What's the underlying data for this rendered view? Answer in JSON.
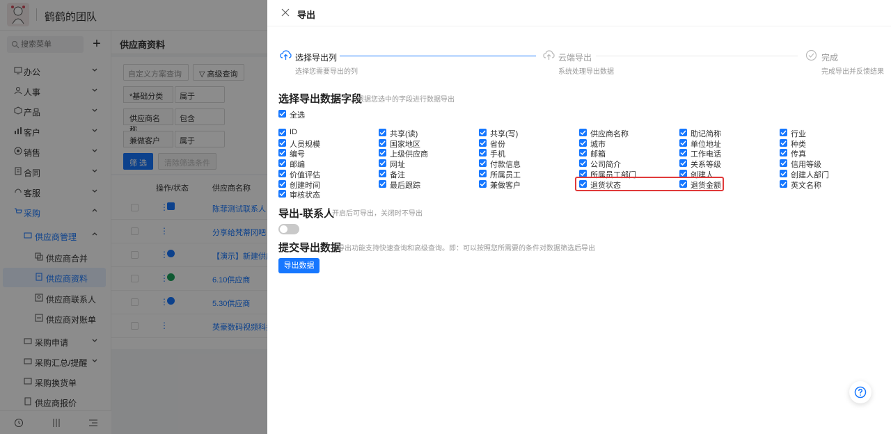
{
  "header": {
    "team_name": "鹤鹤的团队"
  },
  "sidebar": {
    "search_placeholder": "搜索菜单",
    "items": [
      {
        "label": "办公",
        "icon": "desktop-icon"
      },
      {
        "label": "人事",
        "icon": "people-icon"
      },
      {
        "label": "产品",
        "icon": "cube-icon"
      },
      {
        "label": "客户",
        "icon": "chart-icon"
      },
      {
        "label": "销售",
        "icon": "target-icon"
      },
      {
        "label": "合同",
        "icon": "contract-icon"
      },
      {
        "label": "客服",
        "icon": "headset-icon"
      },
      {
        "label": "采购",
        "icon": "cart-icon"
      },
      {
        "label": "供应商管理",
        "icon": "folder-icon"
      },
      {
        "label": "供应商合并",
        "icon": "merge-icon"
      },
      {
        "label": "供应商资料",
        "icon": "document-icon"
      },
      {
        "label": "供应商联系人",
        "icon": "contact-icon"
      },
      {
        "label": "供应商对账单",
        "icon": "statement-icon"
      },
      {
        "label": "采购申请",
        "icon": "folder-icon"
      },
      {
        "label": "采购汇总/提醒",
        "icon": "folder-icon"
      },
      {
        "label": "采购换货单",
        "icon": "exchange-icon"
      },
      {
        "label": "供应商报价",
        "icon": "quote-icon"
      }
    ]
  },
  "main": {
    "title": "供应商资料",
    "custom_query": "自定义方案查询",
    "advanced_query": "高级查询",
    "filters": [
      {
        "label": "*基础分类",
        "op": "属于"
      },
      {
        "label": "供应商名称",
        "op": "包含"
      },
      {
        "label": "兼做客户",
        "op": "属于"
      }
    ],
    "filter_button": "筛 选",
    "clear_button": "清除筛选条件",
    "columns": [
      "操作/状态",
      "供应商名称"
    ],
    "rows": [
      "陈菲测试联系人",
      "分享给梵蒂冈吧",
      "【演示】新建供应商",
      "6.10供应商",
      "5.30供应商",
      "英豪数码视频科技"
    ]
  },
  "drawer": {
    "title": "导出",
    "steps": [
      {
        "title": "选择导出列",
        "desc": "选择您需要导出的列"
      },
      {
        "title": "云端导出",
        "desc": "系统处理导出数据"
      },
      {
        "title": "完成",
        "desc": "完成导出并反馈结果"
      }
    ],
    "fields_section": {
      "title": "选择导出数据字段",
      "hint": "根据您选中的字段进行数据导出"
    },
    "select_all": "全选",
    "fields": [
      "ID",
      "人员规模",
      "编号",
      "邮编",
      "价值评估",
      "创建时间",
      "审核状态",
      "共享(读)",
      "国家地区",
      "上级供应商",
      "网址",
      "备注",
      "最后跟踪",
      "共享(写)",
      "省份",
      "手机",
      "付款信息",
      "所属员工",
      "兼做客户",
      "供应商名称",
      "城市",
      "邮箱",
      "公司简介",
      "所属员工部门",
      "退货状态",
      "助记简称",
      "单位地址",
      "工作电话",
      "关系等级",
      "创建人",
      "退货金额",
      "行业",
      "种类",
      "传真",
      "信用等级",
      "创建人部门",
      "英文名称"
    ],
    "contact_section": {
      "title": "导出-联系人",
      "hint": "开启后可导出，关闭时不导出"
    },
    "submit_section": {
      "title": "提交导出数据",
      "hint": "导出功能支持快速查询和高级查询。即：可以按照您所需要的条件对数据筛选后导出"
    },
    "export_button": "导出数据",
    "colors": {
      "primary": "#1677ff",
      "highlight": "#e03a3a"
    }
  }
}
